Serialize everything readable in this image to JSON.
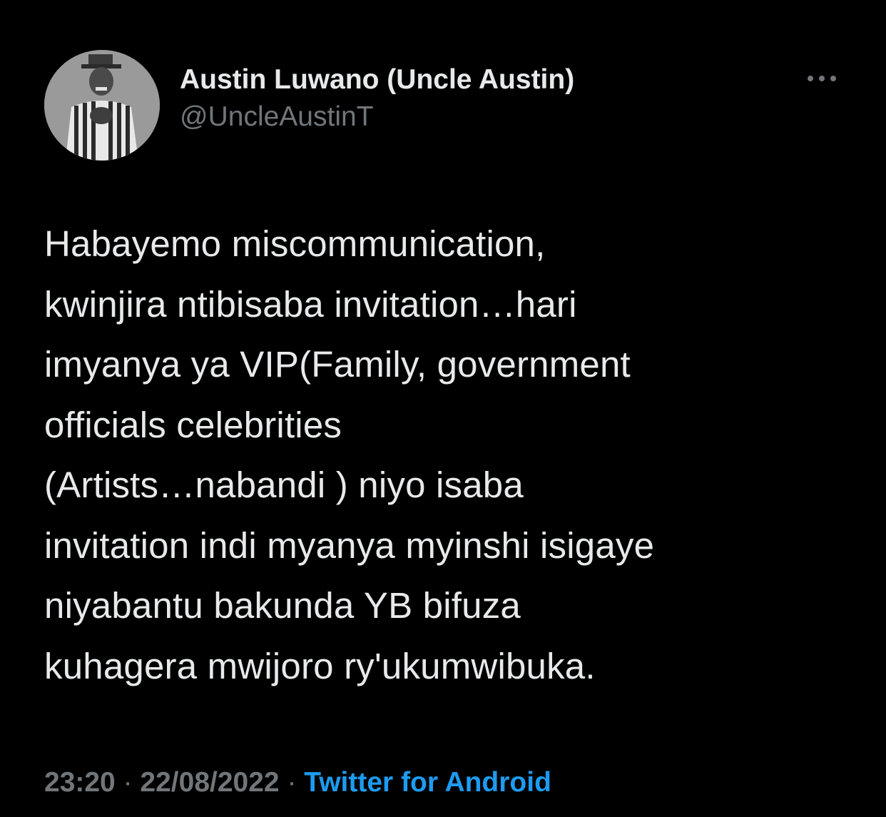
{
  "tweet": {
    "author": {
      "display_name": "Austin Luwano (Uncle Austin)",
      "handle": "@UncleAustinT",
      "avatar_icon": "profile-photo"
    },
    "more_icon": "more-horizontal-icon",
    "text": "Habayemo miscommunication,\nkwinjira ntibisaba invitation…hari\nimyanya ya VIP(Family, government\nofficials celebrities\n(Artists…nabandi ) niyo isaba\ninvitation indi myanya myinshi isigaye\nniyabantu bakunda YB bifuza\nkuhagera mwijoro ry'ukumwibuka.",
    "time": "23:20",
    "separator_1": " · ",
    "date": "22/08/2022",
    "separator_2": " · ",
    "source": "Twitter for Android"
  },
  "colors": {
    "background": "#000000",
    "primary_text": "#e7e9ea",
    "secondary_text": "#71767b",
    "link": "#1d9bf0"
  }
}
